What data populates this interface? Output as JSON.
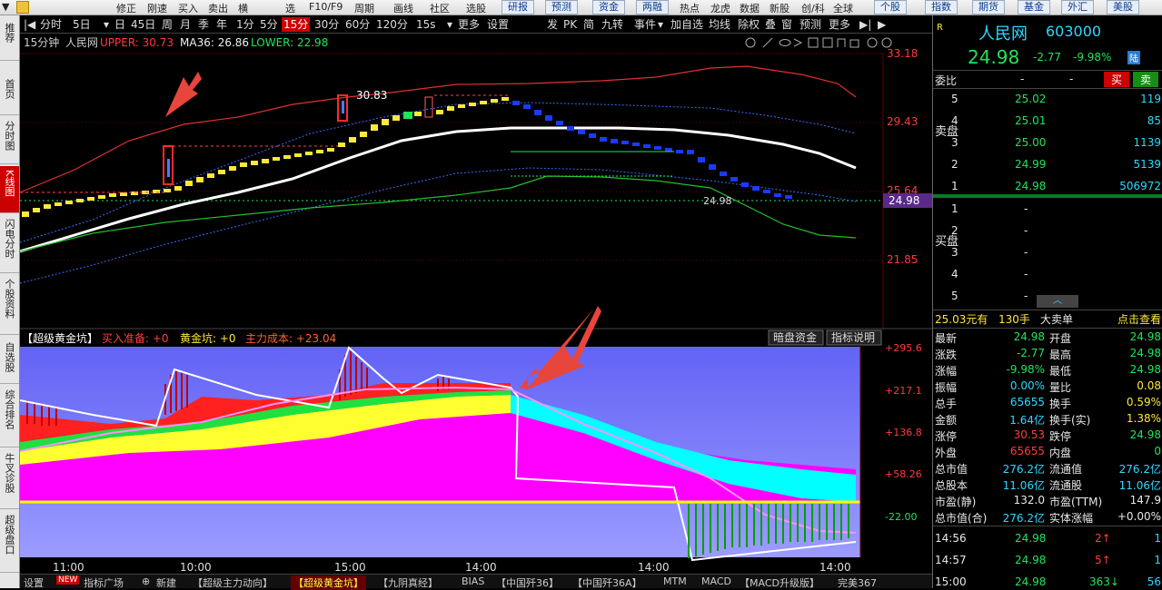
{
  "top_menu": {
    "left_items": [
      "修正",
      "刚速",
      "买入",
      "卖出",
      "横",
      "选",
      "F10/F9",
      "周期",
      "画线",
      "社区",
      "选股"
    ],
    "tabs": [
      "研报",
      "预测",
      "资金",
      "两融",
      "热点",
      "龙虎",
      "数据",
      "新股",
      "创/科",
      "全球",
      "个股",
      "指数",
      "期货",
      "基金",
      "外汇",
      "美股"
    ]
  },
  "left_tabs": [
    "推荐",
    "首页",
    "分时图",
    "K线图",
    "闪电分时",
    "个股资料",
    "自选股",
    "综合排名",
    "牛叉诊股",
    "超级盘口"
  ],
  "toolbar": {
    "items": [
      "分时",
      "5日",
      "日",
      "45日",
      "周",
      "月",
      "季",
      "年",
      "1分",
      "5分",
      "15分",
      "30分",
      "60分",
      "120分",
      "15s",
      "更多",
      "设置"
    ],
    "right_items": [
      "发",
      "PK",
      "简",
      "九转",
      "事件",
      "加自选",
      "均线",
      "除权",
      "叠",
      "窗",
      "预测",
      "更多"
    ],
    "selected": "15分"
  },
  "kline": {
    "period": "15分钟",
    "stock": "人民网",
    "upper_label": "UPPER: 30.73",
    "ma_label": "MA36: 26.86",
    "lower_label": "LOWER: 22.98",
    "price_ticks": [
      "33.18",
      "29.43",
      "25.64",
      "21.85"
    ],
    "current_price_tag": "24.98",
    "high_marker": "30.83",
    "low_marker": "24.98"
  },
  "indicator": {
    "title": "【超级黄金坑】",
    "buy_ready": "买入准备: +0",
    "golden_pit": "黄金坑: +0",
    "main_cost": "主力成本: +23.04",
    "button_dark": "暗盘资金",
    "button_desc": "指标说明",
    "ticks": [
      "+295.6",
      "+217.1",
      "+136.8",
      "+58.26",
      "-22.00"
    ]
  },
  "time_axis": [
    "11:00",
    "10:00",
    "15:00",
    "14:00",
    "14:00",
    "14:00"
  ],
  "bottom_tabs": [
    "设置",
    "NEW",
    "指标广场",
    "新建",
    "【超级主力动向】",
    "【超级黄金坑】",
    "【九阴真经】",
    "BIAS",
    "【中国歼36】",
    "【中国歼36A】",
    "MTM",
    "MACD",
    "【MACD升级版】",
    "完美367"
  ],
  "quote": {
    "market_badge": "R",
    "name": "人民网",
    "code": "603000",
    "price": "24.98",
    "change": "-2.77",
    "pct": "-9.98%",
    "tag": "陆",
    "committee": "委比",
    "committee_val": "-",
    "committee_val2": "-",
    "buy_btn": "买",
    "sell_btn": "卖",
    "sell_label": "卖盘",
    "buy_label": "买盘",
    "sell_levels": [
      {
        "lvl": "5",
        "price": "25.02",
        "vol": "119"
      },
      {
        "lvl": "4",
        "price": "25.01",
        "vol": "85"
      },
      {
        "lvl": "3",
        "price": "25.00",
        "vol": "1139"
      },
      {
        "lvl": "2",
        "price": "24.99",
        "vol": "5139"
      },
      {
        "lvl": "1",
        "price": "24.98",
        "vol": "506972"
      }
    ],
    "buy_levels": [
      {
        "lvl": "1",
        "price": "-",
        "vol": ""
      },
      {
        "lvl": "2",
        "price": "-",
        "vol": ""
      },
      {
        "lvl": "3",
        "price": "-",
        "vol": ""
      },
      {
        "lvl": "4",
        "price": "-",
        "vol": ""
      },
      {
        "lvl": "5",
        "price": "-",
        "vol": ""
      }
    ],
    "big_order": {
      "price": "25.03元有",
      "vol": "130手",
      "label": "大卖单",
      "link": "点击查看"
    },
    "stats": [
      [
        "最新",
        "24.98",
        "开盘",
        "24.98"
      ],
      [
        "涨跌",
        "-2.77",
        "最高",
        "24.98"
      ],
      [
        "涨幅",
        "-9.98%",
        "最低",
        "24.98"
      ],
      [
        "振幅",
        "0.00%",
        "量比",
        "0.08"
      ],
      [
        "总手",
        "65655",
        "换手",
        "0.59%"
      ],
      [
        "金额",
        "1.64亿",
        "换手(实)",
        "1.38%"
      ],
      [
        "涨停",
        "30.53",
        "跌停",
        "24.98"
      ],
      [
        "外盘",
        "65655",
        "内盘",
        "0"
      ],
      [
        "总市值",
        "276.2亿",
        "流通值",
        "276.2亿"
      ],
      [
        "总股本",
        "11.06亿",
        "流通股",
        "11.06亿"
      ],
      [
        "市盈(静)",
        "132.0",
        "市盈(TTM)",
        "147.9"
      ],
      [
        "总市值(合)",
        "276.2亿",
        "实体涨幅",
        "+0.00%"
      ]
    ],
    "ticks": [
      [
        "14:56",
        "24.98",
        "2↑",
        "1"
      ],
      [
        "14:57",
        "24.98",
        "5↑",
        "1"
      ],
      [
        "15:00",
        "24.98",
        "363↓",
        "56"
      ]
    ]
  }
}
